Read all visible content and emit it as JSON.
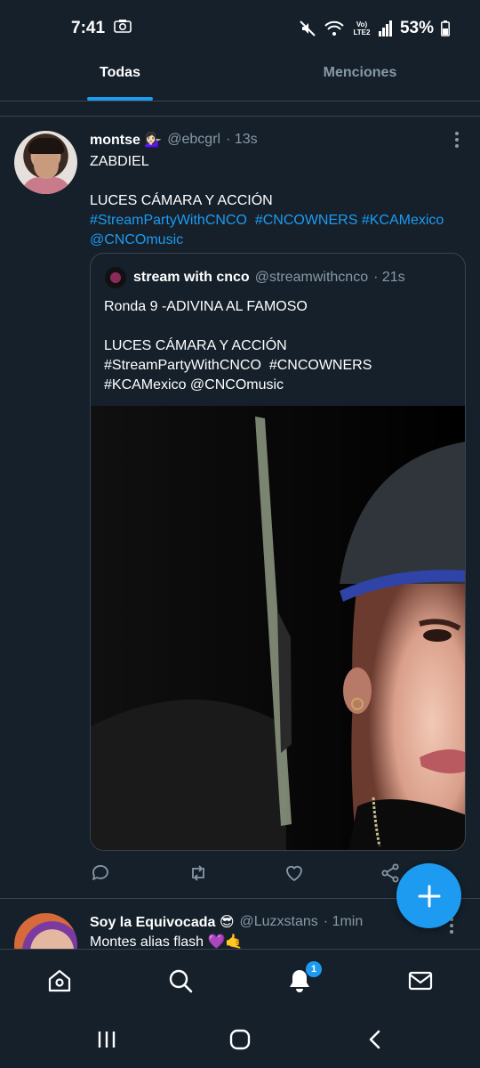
{
  "status": {
    "time": "7:41",
    "battery": "53%",
    "network": "Vo) LTE2"
  },
  "tabs": [
    {
      "label": "Todas",
      "active": true
    },
    {
      "label": "Menciones",
      "active": false
    }
  ],
  "tweet1": {
    "name": "montse 💁🏻‍♀️",
    "handle": "@ebcgrl",
    "time": "· 13s",
    "line1": "ZABDIEL",
    "line2": "LUCES CÁMARA Y ACCIÓN",
    "hashtags": "#StreamPartyWithCNCO  #CNCOWNERS #KCAMexico",
    "mention": "@CNCOmusic"
  },
  "quote": {
    "name": "stream with cnco",
    "handle": "@streamwithcnco",
    "time": "· 21s",
    "line1": "Ronda 9 -ADIVINA AL FAMOSO",
    "line2": "LUCES CÁMARA Y ACCIÓN",
    "line3": "#StreamPartyWithCNCO  #CNCOWNERS",
    "line4": "#KCAMexico @CNCOmusic"
  },
  "tweet2": {
    "name": "Soy la Equivocada 😎",
    "handle": "@Luzxstans",
    "time": "· 1min",
    "text": "Montes alias flash 💜🤙"
  },
  "bottom_nav": {
    "notifications_badge": "1"
  },
  "colors": {
    "background": "#15202b",
    "accent": "#1d9bf0",
    "muted": "#8899a6",
    "border": "#38444d"
  }
}
